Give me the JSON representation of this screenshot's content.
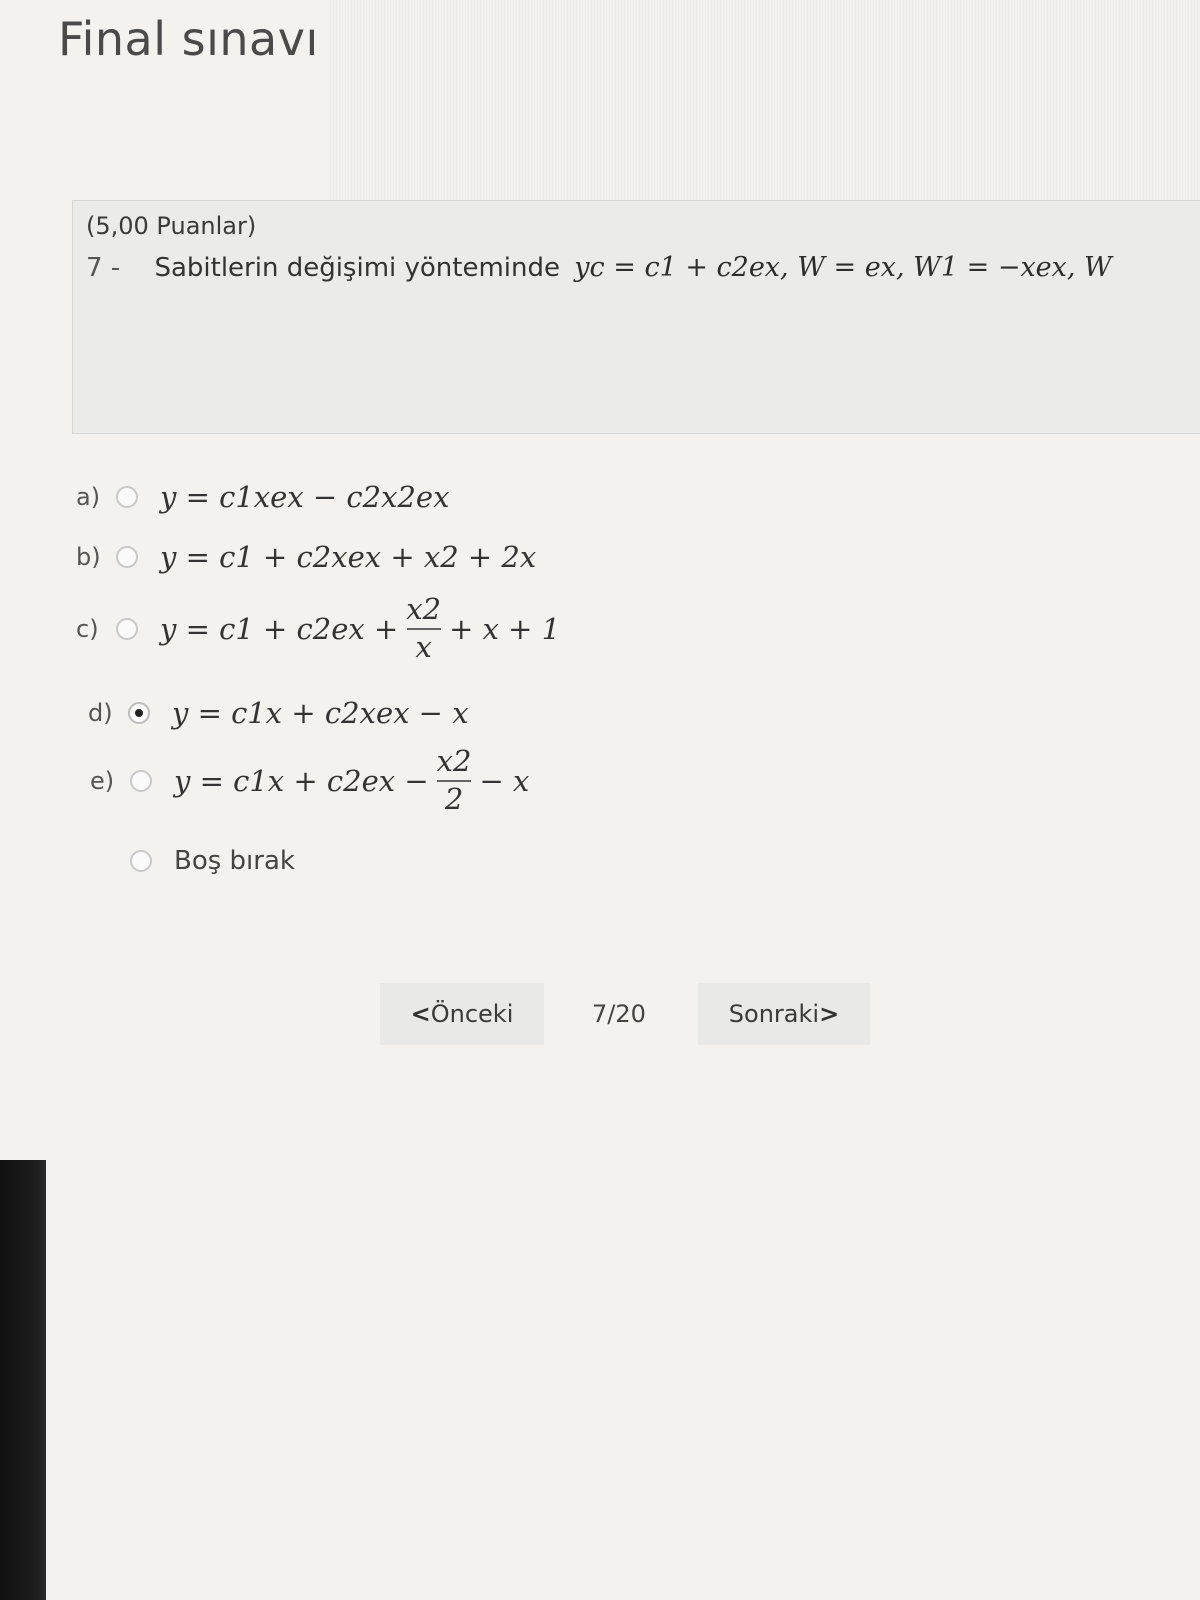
{
  "page": {
    "title": "Final sınavı"
  },
  "question": {
    "points": "(5,00 Puanlar)",
    "number": "7 -",
    "text": "Sabitlerin değişimi yönteminde",
    "math": "yc = c1 + c2ex, W = ex, W1 = −xex, W"
  },
  "options": [
    {
      "letter": "a)",
      "selected": false,
      "parts": [
        "y = c1xex − c2x2ex"
      ]
    },
    {
      "letter": "b)",
      "selected": false,
      "parts": [
        "y = c1 + c2xex + x2 + 2x"
      ]
    },
    {
      "letter": "c)",
      "selected": false,
      "before": "y = c1 + c2ex +",
      "num": "x2",
      "den": "x",
      "after": "+ x + 1"
    },
    {
      "letter": "d)",
      "selected": true,
      "parts": [
        "y = c1x + c2xex − x"
      ]
    },
    {
      "letter": "e)",
      "selected": false,
      "before": "y = c1x + c2ex −",
      "num": "x2",
      "den": "2",
      "after": "− x"
    }
  ],
  "blank_option": {
    "label": "Boş bırak",
    "selected": false
  },
  "navigation": {
    "prev_arrow": "<",
    "prev_label": "Önceki",
    "counter": "7/20",
    "next_label": "Sonraki",
    "next_arrow": ">"
  }
}
